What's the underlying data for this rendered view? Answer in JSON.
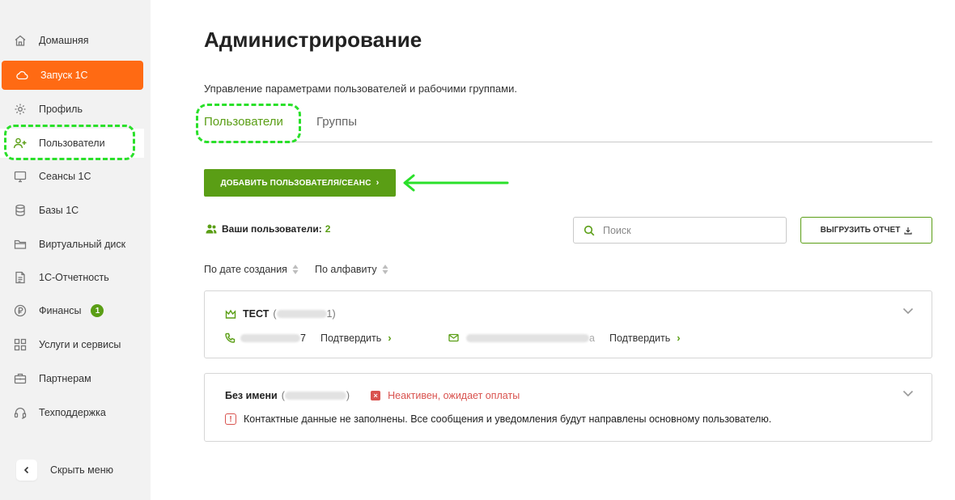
{
  "sidebar": {
    "items": [
      {
        "label": "Домашняя",
        "icon": "home-icon"
      },
      {
        "label": "Запуск 1С",
        "icon": "cloud-icon"
      },
      {
        "label": "Профиль",
        "icon": "gear-icon"
      },
      {
        "label": "Пользователи",
        "icon": "user-add-icon"
      },
      {
        "label": "Сеансы 1С",
        "icon": "monitor-icon"
      },
      {
        "label": "Базы 1С",
        "icon": "database-icon"
      },
      {
        "label": "Виртуальный диск",
        "icon": "folder-icon"
      },
      {
        "label": "1С-Отчетность",
        "icon": "document-icon"
      },
      {
        "label": "Финансы",
        "icon": "ruble-icon",
        "badge": "1"
      },
      {
        "label": "Услуги и сервисы",
        "icon": "grid-icon"
      },
      {
        "label": "Партнерам",
        "icon": "briefcase-icon"
      },
      {
        "label": "Техподдержка",
        "icon": "headset-icon"
      }
    ],
    "collapse_label": "Скрыть меню"
  },
  "header": {
    "title": "Администрирование",
    "subtitle": "Управление параметрами пользователей и рабочими группами."
  },
  "tabs": [
    {
      "label": "Пользователи",
      "active": true
    },
    {
      "label": "Группы",
      "active": false
    }
  ],
  "actions": {
    "add_user_label": "ДОБАВИТЬ ПОЛЬЗОВАТЕЛЯ/СЕАНС",
    "export_label": "ВЫГРУЗИТЬ ОТЧЕТ"
  },
  "users_summary": {
    "label": "Ваши пользователи:",
    "count": "2"
  },
  "search": {
    "placeholder": "Поиск",
    "value": ""
  },
  "sort": {
    "by_date": "По дате создания",
    "by_alpha": "По алфавиту"
  },
  "users": [
    {
      "name": "ТЕСТ",
      "login_open": "(",
      "login_close": "1)",
      "phone_suffix": "7",
      "email_suffix": "a",
      "phone_confirm": "Подтвердить",
      "email_confirm": "Подтвердить"
    },
    {
      "name": "Без имени",
      "login_open": "(",
      "login_close": ")",
      "status": "Неактивен, ожидает оплаты",
      "warning": "Контактные данные не заполнены. Все сообщения и уведомления будут направлены основному пользователю."
    }
  ],
  "colors": {
    "accent_orange": "#ff6a13",
    "brand_green": "#5a9e15",
    "error_red": "#d9534f",
    "highlight_green": "#2ae02a"
  }
}
